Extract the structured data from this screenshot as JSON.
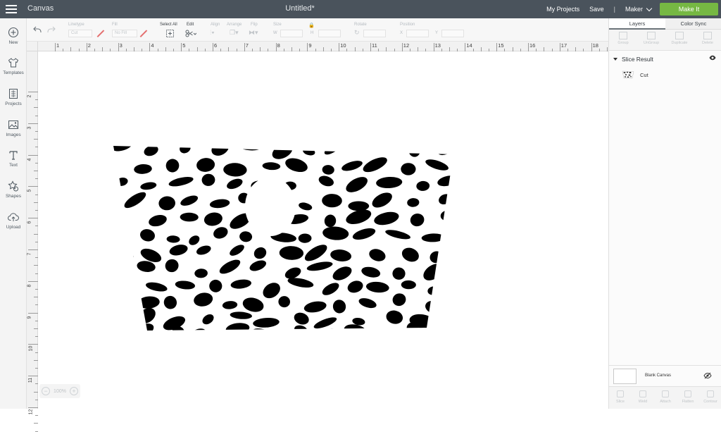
{
  "topbar": {
    "app_title": "Canvas",
    "doc_title": "Untitled*",
    "my_projects": "My Projects",
    "save": "Save",
    "separator": "|",
    "machine": "Maker",
    "make_it": "Make It",
    "make_it_color": "#76b843"
  },
  "leftnav": [
    {
      "label": "New",
      "icon": "plus-circle-icon"
    },
    {
      "label": "Templates",
      "icon": "shirt-icon"
    },
    {
      "label": "Projects",
      "icon": "grid-book-icon"
    },
    {
      "label": "Images",
      "icon": "image-icon"
    },
    {
      "label": "Text",
      "icon": "text-t-icon"
    },
    {
      "label": "Shapes",
      "icon": "shapes-icon"
    },
    {
      "label": "Upload",
      "icon": "cloud-upload-icon"
    }
  ],
  "toolbar": {
    "linetype_label": "Linetype",
    "linetype_value": "Cut",
    "fill_label": "Fill",
    "fill_value": "No Fill",
    "select_all": "Select All",
    "edit": "Edit",
    "align": "Align",
    "arrange": "Arrange",
    "flip": "Flip",
    "size": "Size",
    "w": "W",
    "h": "H",
    "rotate": "Rotate",
    "position": "Position",
    "x": "X",
    "y": "Y"
  },
  "ruler": {
    "top": [
      "1",
      "2",
      "3",
      "4",
      "5",
      "6",
      "7",
      "8",
      "9",
      "10",
      "11",
      "12",
      "13",
      "14",
      "15",
      "16",
      "17",
      "18"
    ],
    "left": [
      "2",
      "3",
      "4",
      "5",
      "6",
      "7",
      "8",
      "9",
      "10",
      "11",
      "12"
    ]
  },
  "zoom": {
    "minus": "−",
    "value": "100%",
    "plus": "+"
  },
  "panel": {
    "tabs": [
      "Layers",
      "Color Sync"
    ],
    "actions": [
      "Group",
      "UnGroup",
      "Duplicate",
      "Delete"
    ],
    "group_name": "Slice Result",
    "layer_name": "Cut",
    "blank_canvas": "Blank Canvas",
    "bottom_actions": [
      "Slice",
      "Weld",
      "Attach",
      "Flatten",
      "Contour"
    ]
  }
}
